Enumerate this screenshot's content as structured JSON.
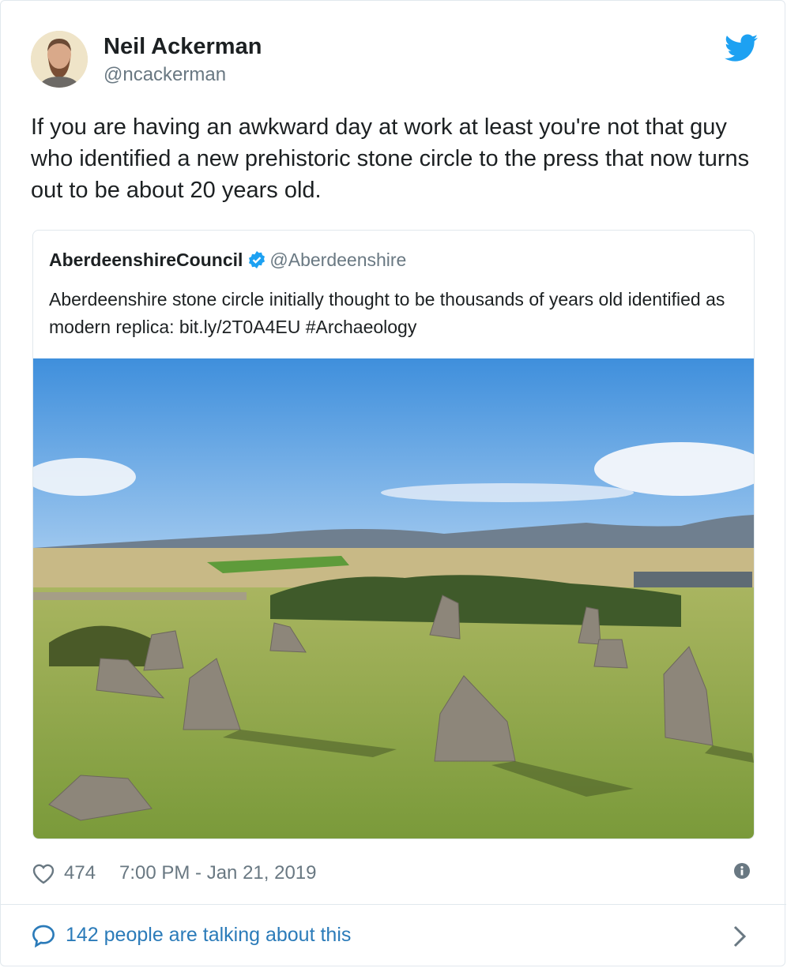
{
  "author": {
    "name": "Neil Ackerman",
    "handle": "@ncackerman"
  },
  "tweet": {
    "text": "If you are having an awkward day at work at least you're not that guy who identified a new prehistoric stone circle to the press that now turns out to be about 20 years old."
  },
  "quoted_tweet": {
    "name": "AberdeenshireCouncil",
    "handle": "@Aberdeenshire",
    "text": "Aberdeenshire stone circle initially thought to be thousands of years old identified as modern replica: bit.ly/2T0A4EU #Archaeology"
  },
  "meta": {
    "likes": "474",
    "timestamp": "7:00 PM - Jan 21, 2019"
  },
  "conversation": {
    "label": "142 people are talking about this"
  },
  "colors": {
    "twitter_blue": "#1da1f2",
    "link_blue": "#2b7bb9",
    "muted_gray": "#697882",
    "border": "#e1e8ed"
  },
  "icons": [
    "twitter-bird-icon",
    "verified-badge-icon",
    "heart-icon",
    "info-icon",
    "speech-bubble-icon",
    "chevron-right-icon"
  ]
}
